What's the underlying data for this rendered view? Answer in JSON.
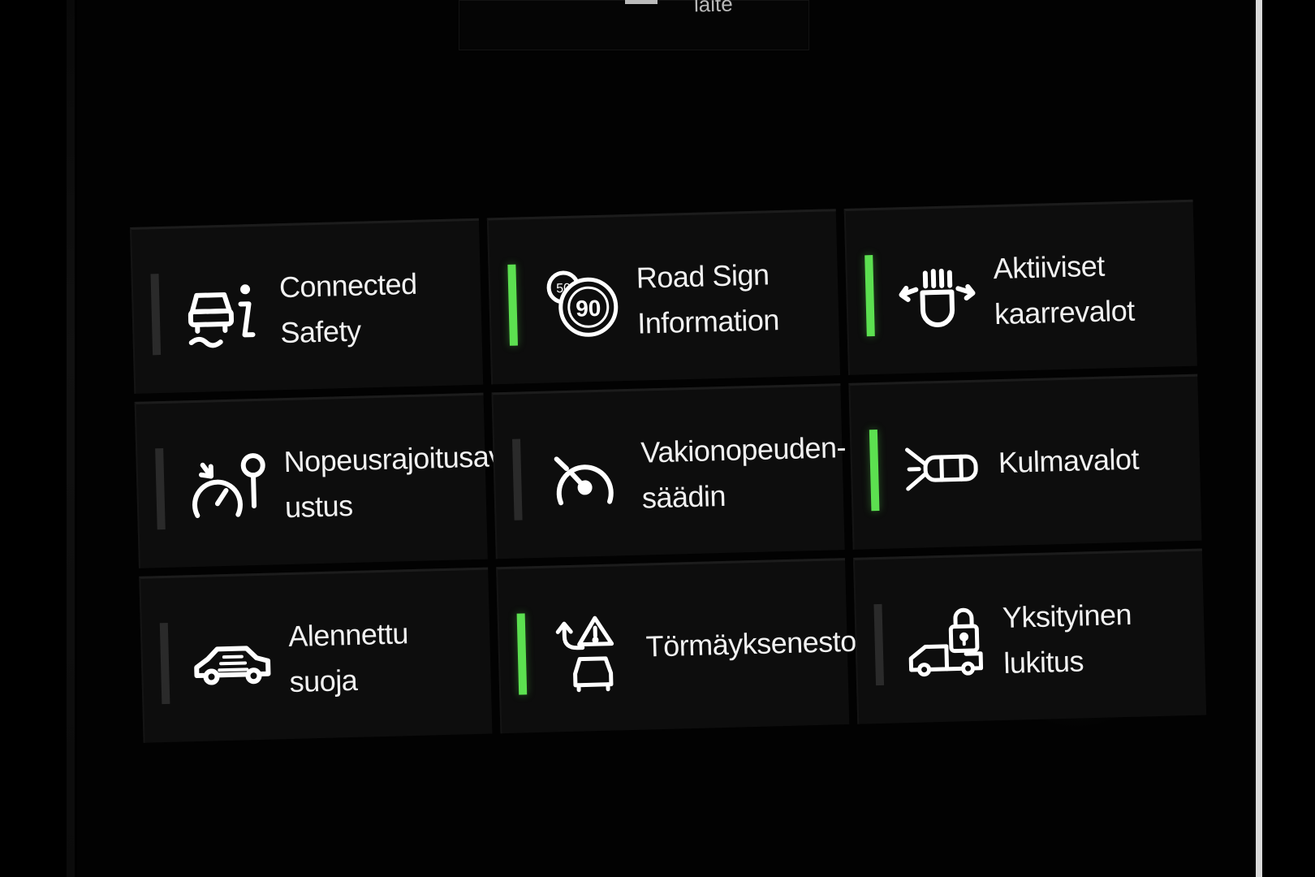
{
  "app": {
    "top_partial_label": "laite"
  },
  "tiles": [
    {
      "label": "Connected\nSafety",
      "icon": "connected-safety-icon",
      "active": false
    },
    {
      "label": "Road Sign\nInformation",
      "icon": "road-sign-speed-90-icon",
      "active": true
    },
    {
      "label": "Aktiiviset\nkaarrevalot",
      "icon": "adaptive-headlight-icon",
      "active": true
    },
    {
      "label": "Nopeusrajoitusav\nustus",
      "icon": "speed-limit-assist-icon",
      "active": false
    },
    {
      "label": "Vakionopeuden-\nsäädin",
      "icon": "cruise-control-icon",
      "active": false
    },
    {
      "label": "Kulmavalot",
      "icon": "cornering-light-icon",
      "active": true
    },
    {
      "label": "Alennettu\nsuoja",
      "icon": "reduced-guard-car-icon",
      "active": false
    },
    {
      "label": "Törmäyksenesto",
      "icon": "collision-avoidance-icon",
      "active": true
    },
    {
      "label": "Yksityinen\nlukitus",
      "icon": "private-lock-icon",
      "active": false
    }
  ],
  "colors": {
    "active_indicator": "#5ce050",
    "inactive_indicator": "#2a2a2a",
    "tile_background": "#0d0d0d",
    "text": "#f1f1f1"
  }
}
